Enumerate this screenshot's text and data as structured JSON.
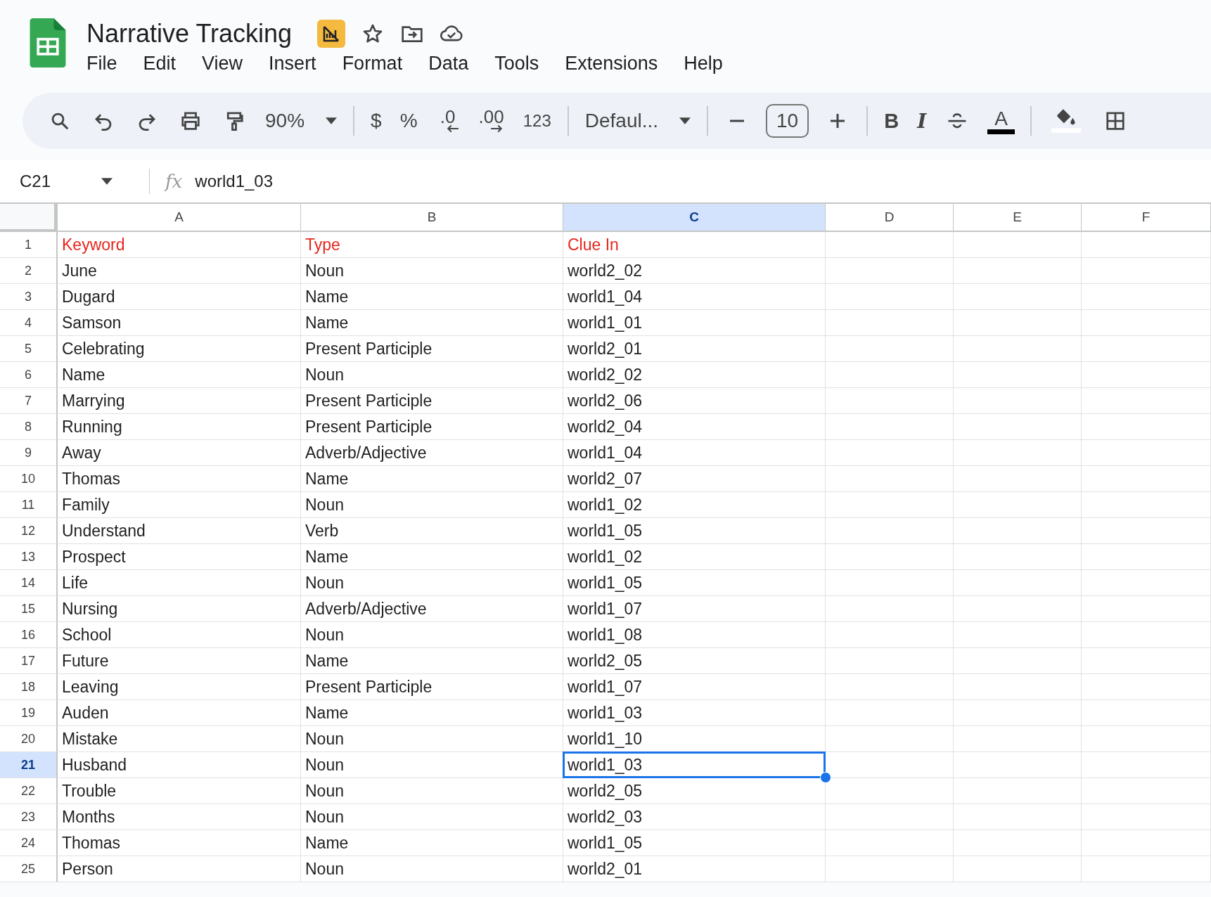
{
  "document": {
    "title": "Narrative Tracking",
    "menu": [
      "File",
      "Edit",
      "View",
      "Insert",
      "Format",
      "Data",
      "Tools",
      "Extensions",
      "Help"
    ]
  },
  "toolbar": [
    {
      "kind": "search"
    },
    {
      "kind": "undo"
    },
    {
      "kind": "redo"
    },
    {
      "kind": "print"
    },
    {
      "kind": "paint"
    },
    {
      "kind": "dropdown",
      "label": "90%"
    },
    {
      "kind": "sep"
    },
    {
      "kind": "text",
      "label": "$"
    },
    {
      "kind": "text",
      "label": "%"
    },
    {
      "kind": "decrease",
      "label": ".0"
    },
    {
      "kind": "increase",
      "label": ".00"
    },
    {
      "kind": "small",
      "label": "123"
    },
    {
      "kind": "sep"
    },
    {
      "kind": "dropdown",
      "label": "Defaul..."
    },
    {
      "kind": "sep"
    },
    {
      "kind": "minus"
    },
    {
      "kind": "size",
      "label": "10"
    },
    {
      "kind": "plus"
    },
    {
      "kind": "sep"
    },
    {
      "kind": "bold",
      "label": "B"
    },
    {
      "kind": "italic",
      "label": "I"
    },
    {
      "kind": "strike"
    },
    {
      "kind": "textcolor",
      "label": "A"
    },
    {
      "kind": "sep"
    },
    {
      "kind": "fill"
    },
    {
      "kind": "borders"
    }
  ],
  "formula_bar": {
    "cell_ref": "C21",
    "fx": "fx",
    "value": "world1_03"
  },
  "columns": [
    {
      "label": "A",
      "selected": false
    },
    {
      "label": "B",
      "selected": false
    },
    {
      "label": "C",
      "selected": true
    },
    {
      "label": "D",
      "selected": false
    },
    {
      "label": "E",
      "selected": false
    },
    {
      "label": "F",
      "selected": false
    }
  ],
  "rows": [
    {
      "number": "1",
      "selected": false,
      "kind": "header",
      "cells": [
        "Keyword",
        "Type",
        "Clue In"
      ]
    },
    {
      "number": "2",
      "selected": false,
      "kind": "data",
      "cells": [
        "June",
        "Noun",
        "world2_02"
      ]
    },
    {
      "number": "3",
      "selected": false,
      "kind": "data",
      "cells": [
        "Dugard",
        "Name",
        "world1_04"
      ]
    },
    {
      "number": "4",
      "selected": false,
      "kind": "data",
      "cells": [
        "Samson",
        "Name",
        "world1_01"
      ]
    },
    {
      "number": "5",
      "selected": false,
      "kind": "data",
      "cells": [
        "Celebrating",
        "Present Participle",
        "world2_01"
      ]
    },
    {
      "number": "6",
      "selected": false,
      "kind": "data",
      "cells": [
        "Name",
        "Noun",
        "world2_02"
      ]
    },
    {
      "number": "7",
      "selected": false,
      "kind": "data",
      "cells": [
        "Marrying",
        "Present Participle",
        "world2_06"
      ]
    },
    {
      "number": "8",
      "selected": false,
      "kind": "data",
      "cells": [
        "Running",
        "Present Participle",
        "world2_04"
      ]
    },
    {
      "number": "9",
      "selected": false,
      "kind": "data",
      "cells": [
        "Away",
        "Adverb/Adjective",
        "world1_04"
      ]
    },
    {
      "number": "10",
      "selected": false,
      "kind": "data",
      "cells": [
        "Thomas",
        "Name",
        "world2_07"
      ]
    },
    {
      "number": "11",
      "selected": false,
      "kind": "data",
      "cells": [
        "Family",
        "Noun",
        "world1_02"
      ]
    },
    {
      "number": "12",
      "selected": false,
      "kind": "data",
      "cells": [
        "Understand",
        "Verb",
        "world1_05"
      ]
    },
    {
      "number": "13",
      "selected": false,
      "kind": "data",
      "cells": [
        "Prospect",
        "Name",
        "world1_02"
      ]
    },
    {
      "number": "14",
      "selected": false,
      "kind": "data",
      "cells": [
        "Life",
        "Noun",
        "world1_05"
      ]
    },
    {
      "number": "15",
      "selected": false,
      "kind": "data",
      "cells": [
        "Nursing",
        "Adverb/Adjective",
        "world1_07"
      ]
    },
    {
      "number": "16",
      "selected": false,
      "kind": "data",
      "cells": [
        "School",
        "Noun",
        "world1_08"
      ]
    },
    {
      "number": "17",
      "selected": false,
      "kind": "data",
      "cells": [
        "Future",
        "Name",
        "world2_05"
      ]
    },
    {
      "number": "18",
      "selected": false,
      "kind": "data",
      "cells": [
        "Leaving",
        "Present Participle",
        "world1_07"
      ]
    },
    {
      "number": "19",
      "selected": false,
      "kind": "data",
      "cells": [
        "Auden",
        "Name",
        "world1_03"
      ]
    },
    {
      "number": "20",
      "selected": false,
      "kind": "data",
      "cells": [
        "Mistake",
        "Noun",
        "world1_10"
      ]
    },
    {
      "number": "21",
      "selected": true,
      "kind": "data",
      "cells": [
        "Husband",
        "Noun",
        "world1_03"
      ]
    },
    {
      "number": "22",
      "selected": false,
      "kind": "data",
      "cells": [
        "Trouble",
        "Noun",
        "world2_05"
      ]
    },
    {
      "number": "23",
      "selected": false,
      "kind": "data",
      "cells": [
        "Months",
        "Noun",
        "world2_03"
      ]
    },
    {
      "number": "24",
      "selected": false,
      "kind": "data",
      "cells": [
        "Thomas",
        "Name",
        "world1_05"
      ]
    },
    {
      "number": "25",
      "selected": false,
      "kind": "data",
      "cells": [
        "Person",
        "Noun",
        "world2_01"
      ]
    }
  ]
}
